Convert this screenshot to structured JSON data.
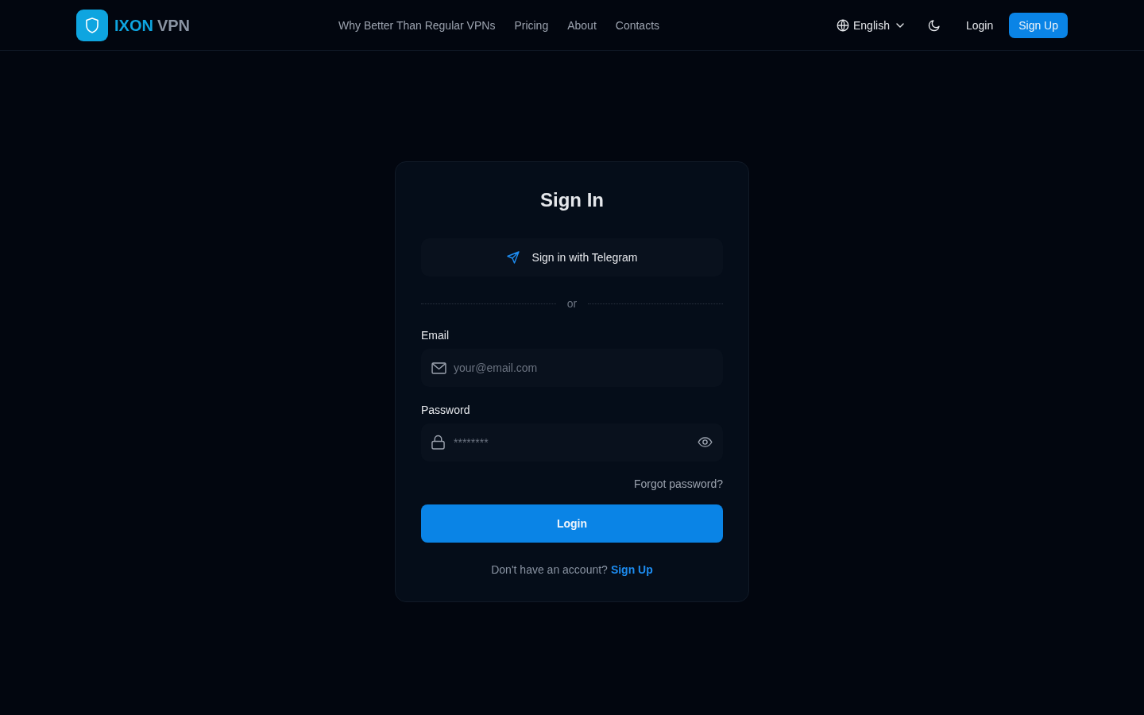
{
  "header": {
    "brand": {
      "name": "IXON",
      "suffix": "VPN"
    },
    "nav": [
      "Why Better Than Regular VPNs",
      "Pricing",
      "About",
      "Contacts"
    ],
    "language": "English",
    "login": "Login",
    "signup": "Sign Up"
  },
  "card": {
    "title": "Sign In",
    "telegram_button": "Sign in with Telegram",
    "divider": "or",
    "fields": [
      {
        "kind": "email",
        "label": "Email",
        "placeholder": "your@email.com"
      },
      {
        "kind": "password",
        "label": "Password",
        "placeholder": "********"
      }
    ],
    "forgot_link": "Forgot password?",
    "submit": "Login",
    "footer": {
      "text": "Don't have an account?",
      "link": "Sign Up"
    }
  }
}
